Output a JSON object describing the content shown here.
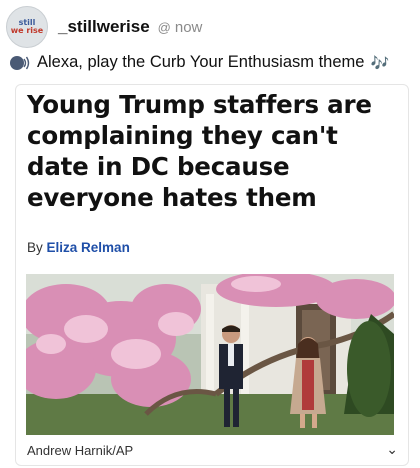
{
  "post": {
    "avatar_line1": "still",
    "avatar_line2": "we rise",
    "username": "_stillwerise",
    "at_symbol": "@",
    "timestamp": "now",
    "caption": "Alexa, play the Curb Your Enthusiasm theme",
    "notes_glyph": "🎶"
  },
  "article": {
    "headline": "Young Trump staffers are complaining they can't date in DC because everyone hates them",
    "byline_prefix": "By",
    "author": "Eliza Relman",
    "photo_credit": "Andrew Harnik/AP",
    "chevron": "⌄"
  },
  "colors": {
    "author_link": "#1f4fa8",
    "muted": "#8a8a8a"
  }
}
